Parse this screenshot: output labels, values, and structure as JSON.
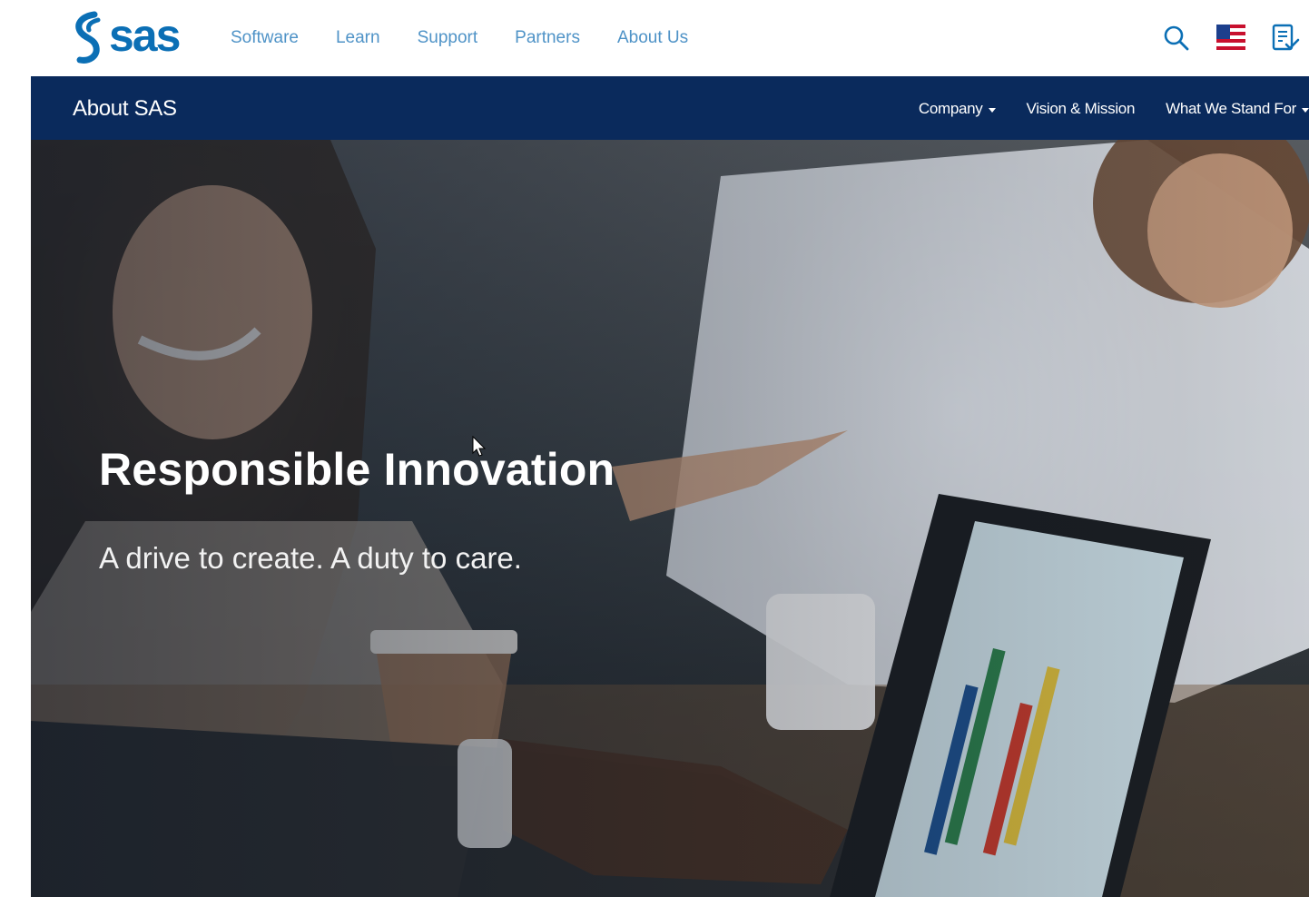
{
  "brand": {
    "logo_text": "sas",
    "color": "#0b6fb5"
  },
  "top_nav": {
    "items": [
      {
        "label": "Software"
      },
      {
        "label": "Learn"
      },
      {
        "label": "Support"
      },
      {
        "label": "Partners"
      },
      {
        "label": "About Us"
      }
    ],
    "link_color": "#4f93c7"
  },
  "header_icons": {
    "search": "search-icon",
    "region": "us-flag-icon",
    "register": "register-icon"
  },
  "sub_nav": {
    "title": "About SAS",
    "background": "#0a2a5c",
    "items": [
      {
        "label": "Company",
        "has_dropdown": true
      },
      {
        "label": "Vision & Mission",
        "has_dropdown": false
      },
      {
        "label": "What We Stand For",
        "has_dropdown": true
      }
    ]
  },
  "hero": {
    "title": "Responsible Innovation",
    "subtitle": "A drive to create. A duty to care."
  }
}
